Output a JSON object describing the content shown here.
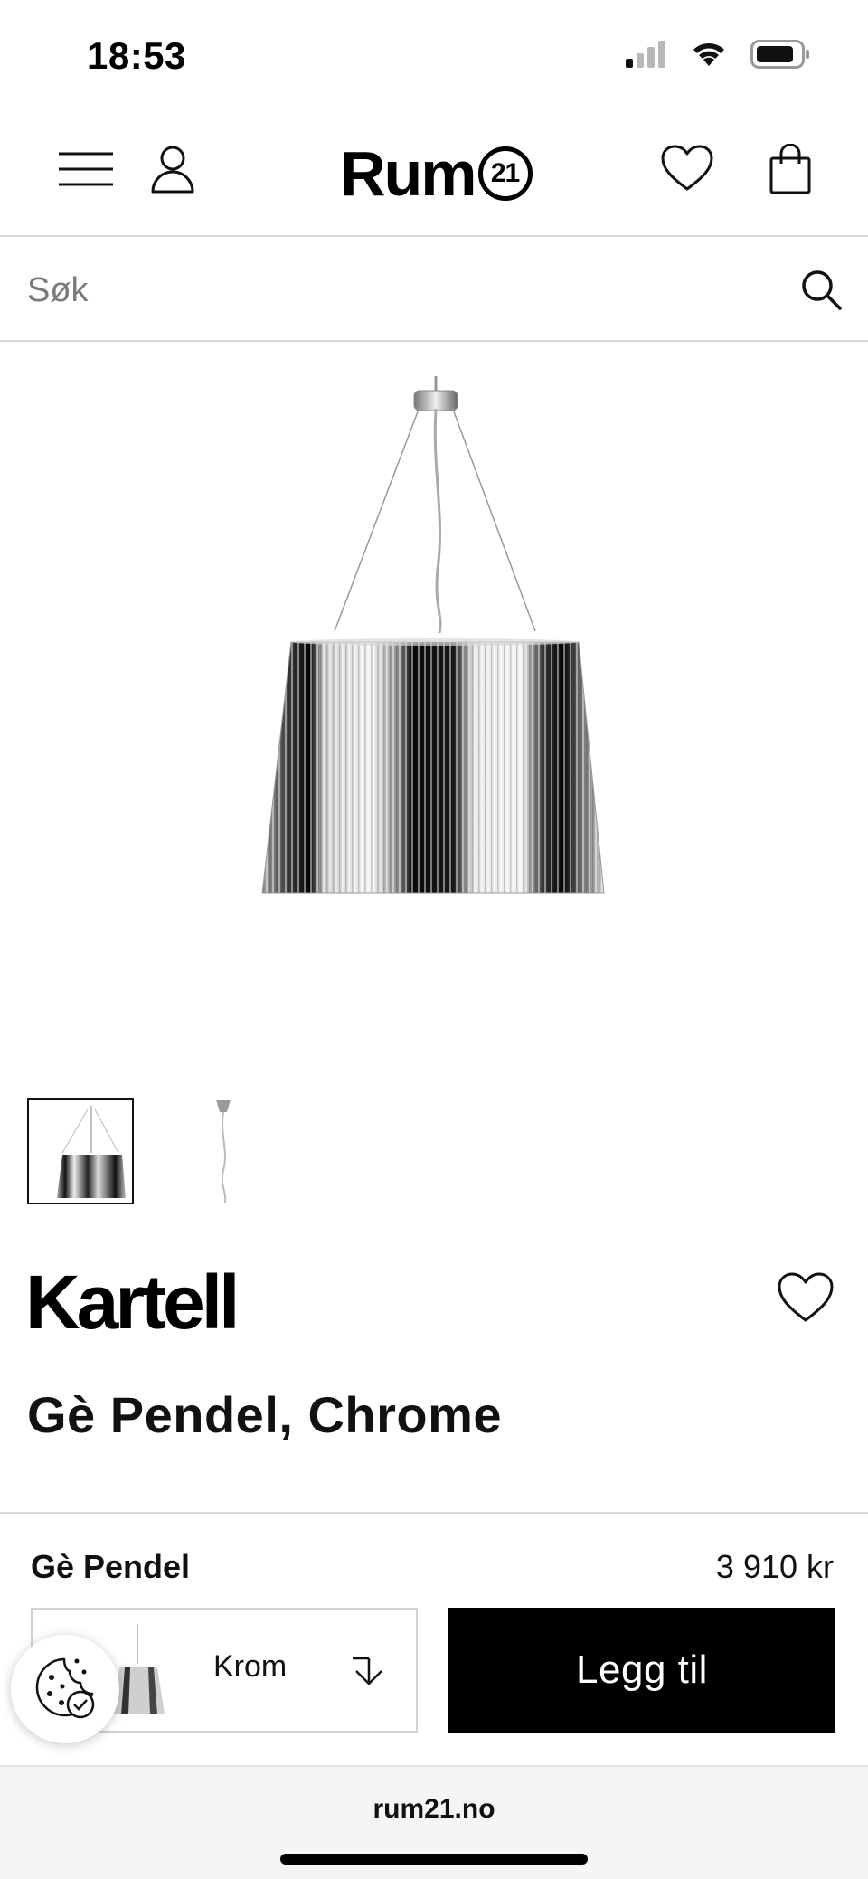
{
  "status_bar": {
    "time": "18:53",
    "icons": [
      "signal-icon",
      "wifi-icon",
      "battery-icon"
    ]
  },
  "header": {
    "logo_text": "Rum",
    "logo_badge": "21",
    "icons": [
      "hamburger-menu-icon",
      "user-icon",
      "heart-icon",
      "shopping-bag-icon"
    ]
  },
  "search": {
    "placeholder": "Søk",
    "value": ""
  },
  "gallery": {
    "image_count": 2,
    "selected_index": 0
  },
  "product": {
    "brand": "Kartell",
    "title": "Gè Pendel, Chrome"
  },
  "buy_panel": {
    "name": "Gè Pendel",
    "price": "3 910 kr",
    "variant": "Krom",
    "add_to_cart_label": "Legg til"
  },
  "browser": {
    "url": "rum21.no"
  },
  "colors": {
    "accent": "#000000",
    "divider": "#d9d9d9",
    "browser_bar": "#f5f5f5"
  }
}
